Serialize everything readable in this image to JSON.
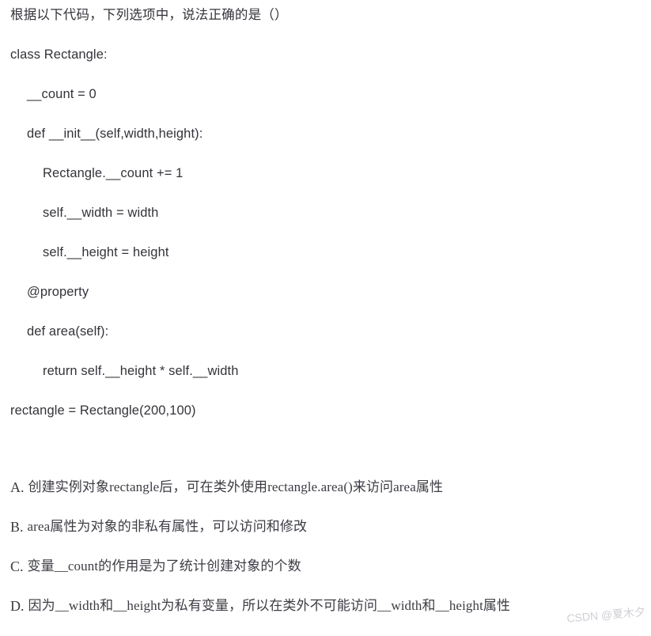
{
  "document": {
    "stem": "根据以下代码，下列选项中，说法正确的是（）",
    "code_lines": [
      {
        "indent": 0,
        "text": "class Rectangle:"
      },
      {
        "indent": 1,
        "text": "__count = 0"
      },
      {
        "indent": 1,
        "text": "def __init__(self,width,height):"
      },
      {
        "indent": 2,
        "text": "Rectangle.__count += 1"
      },
      {
        "indent": 2,
        "text": "self.__width = width"
      },
      {
        "indent": 2,
        "text": "self.__height = height"
      },
      {
        "indent": 1,
        "text": "@property"
      },
      {
        "indent": 1,
        "text": "def area(self):"
      },
      {
        "indent": 2,
        "text": "return self.__height * self.__width"
      },
      {
        "indent": 0,
        "text": "rectangle = Rectangle(200,100)"
      }
    ],
    "options": [
      {
        "letter": "A.",
        "text": "创建实例对象rectangle后，可在类外使用rectangle.area()来访问area属性"
      },
      {
        "letter": "B.",
        "text": "area属性为对象的非私有属性，可以访问和修改"
      },
      {
        "letter": "C.",
        "text": "变量__count的作用是为了统计创建对象的个数"
      },
      {
        "letter": "D.",
        "text": "因为__width和__height为私有变量，所以在类外不可能访问__width和__height属性"
      }
    ],
    "watermark": "CSDN @夏木夕"
  }
}
